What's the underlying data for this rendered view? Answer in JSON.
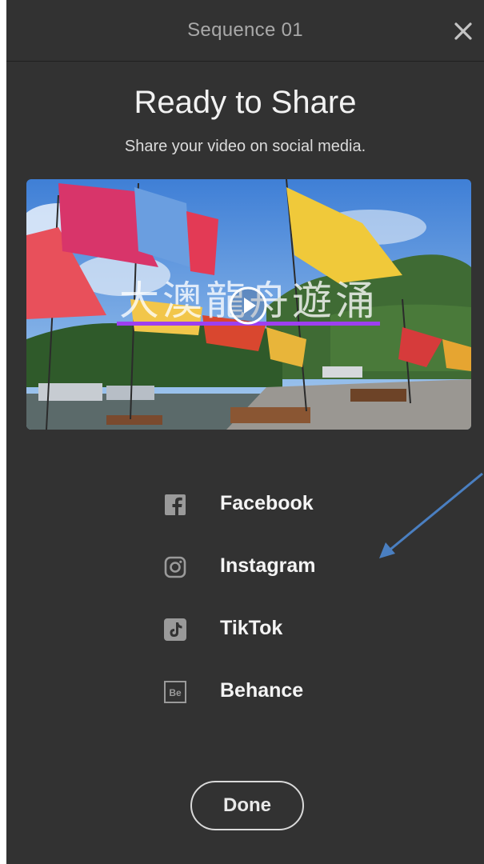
{
  "header": {
    "title": "Sequence 01",
    "close_icon": "close-icon"
  },
  "main": {
    "title": "Ready to Share",
    "subtitle": "Share your video on social media."
  },
  "video": {
    "caption": "大澳龍舟遊涌",
    "play_icon": "play-icon",
    "progress_fraction": 1.0,
    "progress_color": "#9d3ff0"
  },
  "share_options": [
    {
      "label": "Facebook",
      "icon": "facebook-icon"
    },
    {
      "label": "Instagram",
      "icon": "instagram-icon"
    },
    {
      "label": "TikTok",
      "icon": "tiktok-icon"
    },
    {
      "label": "Behance",
      "icon": "behance-icon"
    }
  ],
  "done_label": "Done",
  "colors": {
    "panel_background": "#323232",
    "annotation_arrow": "#4a7fc1"
  }
}
